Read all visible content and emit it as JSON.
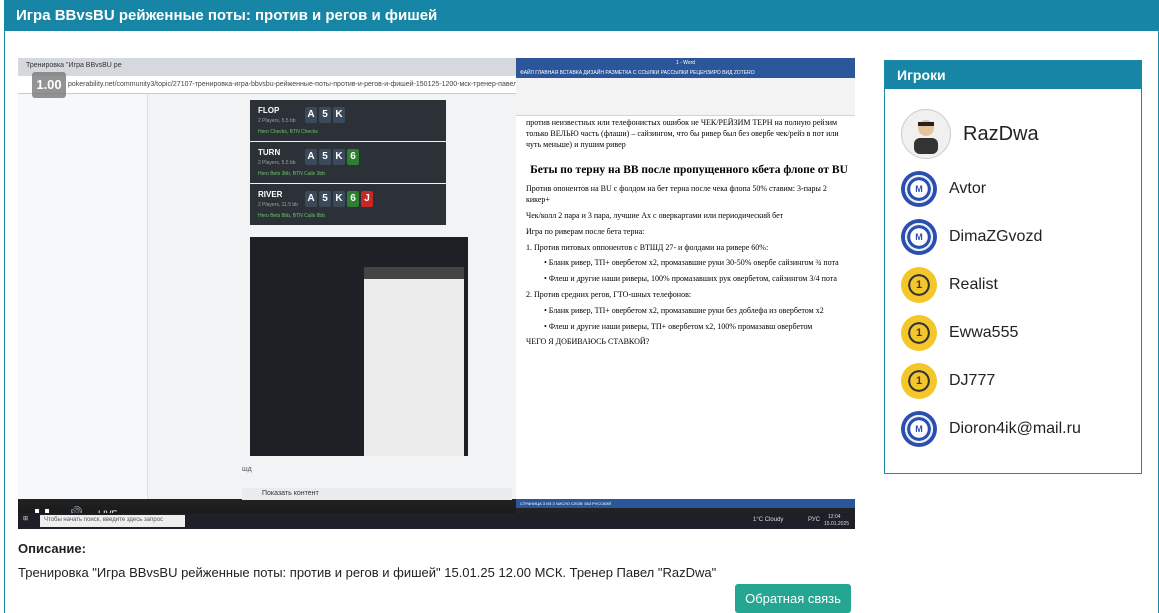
{
  "page": {
    "title": "Игра BBvsBU рейженные поты: против и регов и фишей"
  },
  "video": {
    "speed_label": "1.00",
    "browser_tab": "Тренировка \"Игра BBvsBU ре",
    "browser_url": "pokerability.net/community3/topic/27107-тренировка-игра-bbvsbu-рейженные-поты-против-и-регов-и-фишей-150125-1200-мск-тренер-павел-razdwa/",
    "streets": [
      {
        "street": "FLOP",
        "info": "2 Players, 5.5 bb",
        "action": "Hero Checks, BTN Checks",
        "cards": [
          "A",
          "5",
          "K"
        ]
      },
      {
        "street": "TURN",
        "info": "2 Players, 5.5 bb",
        "action": "Hero Bets 3bb, BTN Calls 3bb",
        "cards": [
          "A",
          "5",
          "K",
          "6"
        ]
      },
      {
        "street": "RIVER",
        "info": "2 Players, 11.5 bb",
        "action": "Hero Bets 8bb, BTN Calls 8bb",
        "cards": [
          "A",
          "5",
          "K",
          "6",
          "J"
        ]
      }
    ],
    "caption_small": "шд",
    "show_content": "Показать контент",
    "live_label": "LIVE",
    "word_title": "1 - Word",
    "word_menu": "ФАЙЛ  ГЛАВНАЯ  ВСТАВКА  ДИЗАЙН  РАЗМЕТКА С  ССЫЛКИ  РАССЫЛКИ  РЕЦЕНЗИРО  ВИД  ZOTERO",
    "doc": {
      "intro": "против неизвестных или телефонистых ошибок не ЧЕК/РЕЙЗИМ ТЕРН на полную рейзим только ВЕЛЬЮ часть (флаши) – сайзингом, что бы ривер был без овербе чек/рейз в пот или чуть меньше) и пушим ривер",
      "heading": "Беты по терну на BB после пропущенного кбета флопе от BU",
      "p1": "Против опонентов на BU с фолдом на бет терна после чека флопа 50% ставим: 3-пары 2 кикер+",
      "p2": "Чек/колл 2 пара и 3 пара, лучшие Ах с оверкартами или периодический бет",
      "p3": "Игра по риверам после бета терна:",
      "li1": "1. Против питовых оппонентов с ВТШД 27- и фолдами на ривере 60%:",
      "li1a": "• Бланк ривер, ТП+ овербетом x2, промазавшие руки 30-50% овербе сайзингом ¾ пота",
      "li1b": "• Флеш и другие наши риверы, 100% промазавших рук овербетом, сайзингом 3/4 пота",
      "li2": "2. Против средних регов, ГТО-шных телефонов:",
      "li2a": "• Бланк ривер, ТП+ овербетом x2, промазавшие руки без доблефа из овербетом x2",
      "li2b": "• Флеш и другие наши риверы, ТП+ овербетом x2, 100% промазавш овербетом",
      "p4": "ЧЕГО Я ДОБИВАЮСЬ СТАВКОЙ?"
    },
    "word_status": "СТРАНИЦА 3 ИЗ 3   ЧИСЛО СЛОВ: 563   РУССКИЙ",
    "taskbar_search": "Чтобы начать поиск, введите здесь запрос",
    "taskbar_weather": "1°C Cloudy",
    "taskbar_lang": "РУС",
    "taskbar_time": "12:04",
    "taskbar_date": "15.01.2025"
  },
  "description": {
    "label": "Описание:",
    "text": "Тренировка \"Игра BBvsBU рейженные поты: против и регов и фишей\" 15.01.25 12.00 МСК. Тренер Павел \"RazDwa\""
  },
  "feedback_button": "Обратная связь",
  "players": {
    "title": "Игроки",
    "list": [
      {
        "name": "RazDwa",
        "chip": "avatar"
      },
      {
        "name": "Avtor",
        "chip": "m"
      },
      {
        "name": "DimaZGvozd",
        "chip": "m"
      },
      {
        "name": "Realist",
        "chip": "gold"
      },
      {
        "name": "Ewwa555",
        "chip": "gold"
      },
      {
        "name": "DJ777",
        "chip": "gold"
      },
      {
        "name": "Dioron4ik@mail.ru",
        "chip": "m"
      }
    ]
  },
  "colors": {
    "header": "#1786a6",
    "button": "#25a693"
  }
}
